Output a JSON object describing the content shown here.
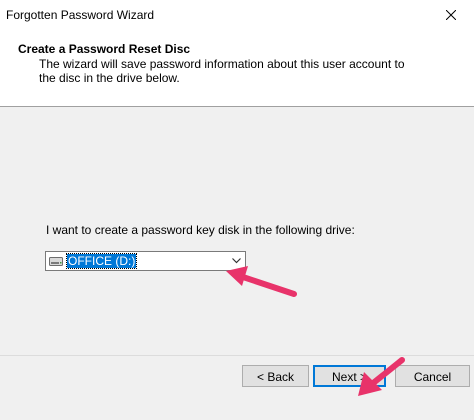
{
  "window": {
    "title": "Forgotten Password Wizard"
  },
  "header": {
    "title": "Create a Password Reset Disc",
    "description": "The wizard will save password information about this user account to the disc in the drive below."
  },
  "main": {
    "prompt": "I want to create a password key disk in the following drive:",
    "drive_select": {
      "selected_value": "OFFICE (D:)",
      "icon": "drive-icon"
    }
  },
  "footer": {
    "back_label": "< Back",
    "next_label": "Next >",
    "cancel_label": "Cancel"
  },
  "colors": {
    "accent": "#0078d7",
    "annotation_arrow": "#e8336a"
  }
}
